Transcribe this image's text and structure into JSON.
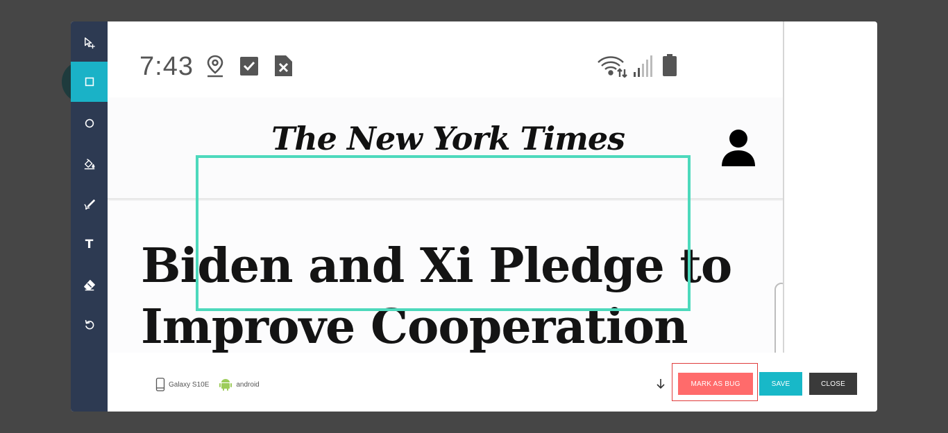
{
  "toolbar": {
    "tools": [
      {
        "name": "select-add-tool",
        "icon": "cursor-plus-icon"
      },
      {
        "name": "rectangle-tool",
        "icon": "square-icon",
        "active": true
      },
      {
        "name": "ellipse-tool",
        "icon": "circle-icon"
      },
      {
        "name": "fill-tool",
        "icon": "paint-bucket-icon"
      },
      {
        "name": "pen-tool",
        "icon": "pen-icon"
      },
      {
        "name": "text-tool",
        "icon": "text-icon",
        "glyph": "T"
      },
      {
        "name": "eraser-tool",
        "icon": "eraser-icon"
      },
      {
        "name": "undo-tool",
        "icon": "undo-icon"
      }
    ]
  },
  "phone": {
    "status_bar": {
      "time": "7:43"
    },
    "nyt": {
      "masthead": "The New York Times"
    },
    "article": {
      "headline": "Biden and Xi Pledge to Improve Cooperation but"
    }
  },
  "annotation": {
    "color": "#4dd9bc"
  },
  "footer": {
    "device_name": "Galaxy S10E",
    "platform": "android",
    "buttons": {
      "mark_as_bug": "MARK AS BUG",
      "save": "SAVE",
      "close": "CLOSE"
    }
  },
  "colors": {
    "toolbar_bg": "#2d3a52",
    "active_tool": "#1ab2c7",
    "mark_as_bug": "#ff6b6b",
    "save": "#18b8c8",
    "close": "#3a3a3a"
  }
}
